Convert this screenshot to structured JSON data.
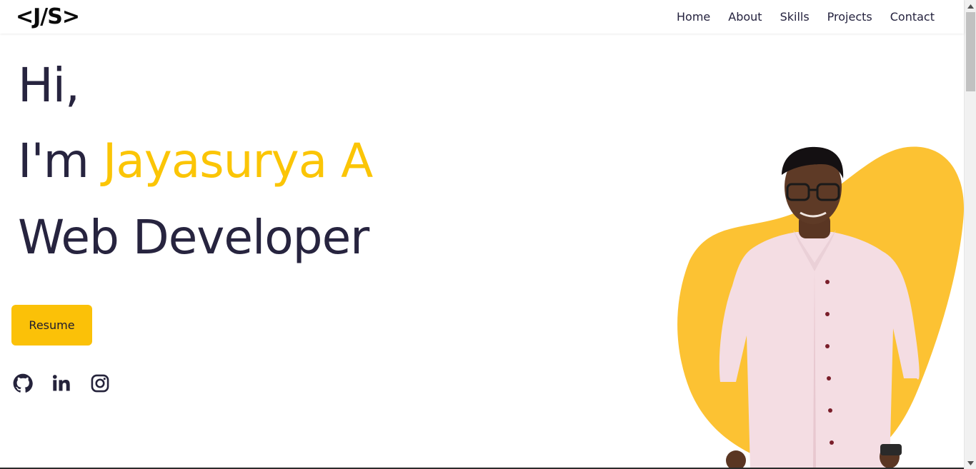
{
  "header": {
    "logo": "<J/S>",
    "nav": [
      "Home",
      "About",
      "Skills",
      "Projects",
      "Contact"
    ]
  },
  "hero": {
    "greeting": "Hi,",
    "intro_prefix": "I'm ",
    "name": "Jayasurya A",
    "role": "Web Developer",
    "resume_label": "Resume"
  },
  "socials": [
    {
      "icon": "github-icon"
    },
    {
      "icon": "linkedin-icon"
    },
    {
      "icon": "instagram-icon"
    }
  ],
  "colors": {
    "accent": "#fbc108",
    "text_dark": "#27243f",
    "blob": "#fcc233"
  }
}
